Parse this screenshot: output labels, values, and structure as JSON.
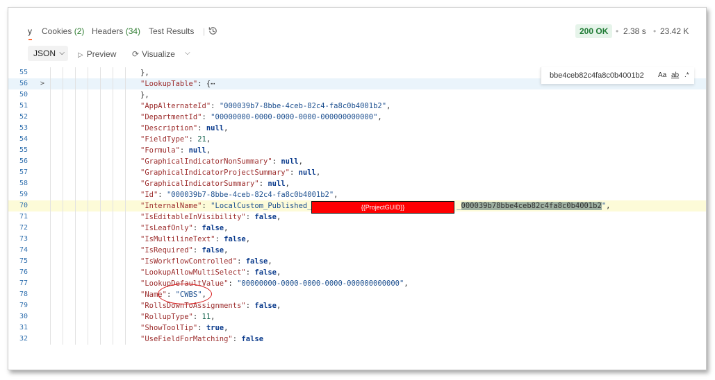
{
  "tabs": {
    "partial_label": "y",
    "cookies_label": "Cookies",
    "cookies_count": "(2)",
    "headers_label": "Headers",
    "headers_count": "(34)",
    "tests_label": "Test Results",
    "separator": "|"
  },
  "response_meta": {
    "status": "200 OK",
    "dot": "•",
    "time": "2.38 s",
    "size": "23.42 K"
  },
  "toolbar": {
    "format": "JSON",
    "preview_label": "Preview",
    "visualize_label": "Visualize"
  },
  "find": {
    "query": "bbe4ceb82c4fa8c0b4001b2",
    "match_case": "Aa",
    "whole_word": "ab",
    "regex": ".*"
  },
  "redaction": {
    "label": "{{ProjectGUID}}"
  },
  "colors": {
    "accent_orange": "#ff6c37",
    "status_green": "#1e7b34",
    "redaction_red": "#ff0000",
    "annotation_red": "#d81b1b"
  },
  "code_lines": [
    {
      "num": "55",
      "tokens": [
        [
          "p",
          "},"
        ]
      ]
    },
    {
      "num": "56",
      "fold": ">",
      "tokens": [
        [
          "k",
          "\"LookupTable\""
        ],
        [
          "p",
          ": {"
        ],
        [
          "p",
          "⋯"
        ]
      ]
    },
    {
      "num": "50",
      "tokens": [
        [
          "p",
          "},"
        ]
      ]
    },
    {
      "num": "51",
      "tokens": [
        [
          "k",
          "\"AppAlternateId\""
        ],
        [
          "p",
          ": "
        ],
        [
          "s",
          "\"000039b7-8bbe-4ceb-82c4-fa8c0b4001b2\""
        ],
        [
          "p",
          ","
        ]
      ]
    },
    {
      "num": "52",
      "tokens": [
        [
          "k",
          "\"DepartmentId\""
        ],
        [
          "p",
          ": "
        ],
        [
          "s",
          "\"00000000-0000-0000-0000-000000000000\""
        ],
        [
          "p",
          ","
        ]
      ]
    },
    {
      "num": "53",
      "tokens": [
        [
          "k",
          "\"Description\""
        ],
        [
          "p",
          ": "
        ],
        [
          "b",
          "null"
        ],
        [
          "p",
          ","
        ]
      ]
    },
    {
      "num": "54",
      "tokens": [
        [
          "k",
          "\"FieldType\""
        ],
        [
          "p",
          ": "
        ],
        [
          "n",
          "21"
        ],
        [
          "p",
          ","
        ]
      ]
    },
    {
      "num": "55",
      "tokens": [
        [
          "k",
          "\"Formula\""
        ],
        [
          "p",
          ": "
        ],
        [
          "b",
          "null"
        ],
        [
          "p",
          ","
        ]
      ]
    },
    {
      "num": "56",
      "tokens": [
        [
          "k",
          "\"GraphicalIndicatorNonSummary\""
        ],
        [
          "p",
          ": "
        ],
        [
          "b",
          "null"
        ],
        [
          "p",
          ","
        ]
      ]
    },
    {
      "num": "57",
      "tokens": [
        [
          "k",
          "\"GraphicalIndicatorProjectSummary\""
        ],
        [
          "p",
          ": "
        ],
        [
          "b",
          "null"
        ],
        [
          "p",
          ","
        ]
      ]
    },
    {
      "num": "58",
      "tokens": [
        [
          "k",
          "\"GraphicalIndicatorSummary\""
        ],
        [
          "p",
          ": "
        ],
        [
          "b",
          "null"
        ],
        [
          "p",
          ","
        ]
      ]
    },
    {
      "num": "59",
      "tokens": [
        [
          "k",
          "\"Id\""
        ],
        [
          "p",
          ": "
        ],
        [
          "s",
          "\"000039b7-8bbe-4ceb-82c4-fa8c0b4001b2\""
        ],
        [
          "p",
          ","
        ]
      ]
    },
    {
      "num": "70",
      "tokens": [
        [
          "k",
          "\"InternalName\""
        ],
        [
          "p",
          ": "
        ],
        [
          "s",
          "\"LocalCustom_Published_"
        ],
        [
          "gap",
          "                                 "
        ],
        [
          "s",
          "_"
        ],
        [
          "sel",
          "000039b78bbe4ceb82c4fa8c0b4001b2"
        ],
        [
          "s",
          "\""
        ],
        [
          "p",
          ","
        ]
      ]
    },
    {
      "num": "71",
      "tokens": [
        [
          "k",
          "\"IsEditableInVisibility\""
        ],
        [
          "p",
          ": "
        ],
        [
          "b",
          "false"
        ],
        [
          "p",
          ","
        ]
      ]
    },
    {
      "num": "72",
      "tokens": [
        [
          "k",
          "\"IsLeafOnly\""
        ],
        [
          "p",
          ": "
        ],
        [
          "b",
          "false"
        ],
        [
          "p",
          ","
        ]
      ]
    },
    {
      "num": "73",
      "tokens": [
        [
          "k",
          "\"IsMultilineText\""
        ],
        [
          "p",
          ": "
        ],
        [
          "b",
          "false"
        ],
        [
          "p",
          ","
        ]
      ]
    },
    {
      "num": "74",
      "tokens": [
        [
          "k",
          "\"IsRequired\""
        ],
        [
          "p",
          ": "
        ],
        [
          "b",
          "false"
        ],
        [
          "p",
          ","
        ]
      ]
    },
    {
      "num": "75",
      "tokens": [
        [
          "k",
          "\"IsWorkflowControlled\""
        ],
        [
          "p",
          ": "
        ],
        [
          "b",
          "false"
        ],
        [
          "p",
          ","
        ]
      ]
    },
    {
      "num": "76",
      "tokens": [
        [
          "k",
          "\"LookupAllowMultiSelect\""
        ],
        [
          "p",
          ": "
        ],
        [
          "b",
          "false"
        ],
        [
          "p",
          ","
        ]
      ]
    },
    {
      "num": "77",
      "tokens": [
        [
          "k",
          "\"LookupDefaultValue\""
        ],
        [
          "p",
          ": "
        ],
        [
          "s",
          "\"00000000-0000-0000-0000-000000000000\""
        ],
        [
          "p",
          ","
        ]
      ]
    },
    {
      "num": "78",
      "tokens": [
        [
          "k",
          "\"Name\""
        ],
        [
          "p",
          ": "
        ],
        [
          "s",
          "\"CWBS\""
        ],
        [
          "p",
          ","
        ]
      ]
    },
    {
      "num": "79",
      "tokens": [
        [
          "k",
          "\"RollsDownToAssignments\""
        ],
        [
          "p",
          ": "
        ],
        [
          "b",
          "false"
        ],
        [
          "p",
          ","
        ]
      ]
    },
    {
      "num": "30",
      "tokens": [
        [
          "k",
          "\"RollupType\""
        ],
        [
          "p",
          ": "
        ],
        [
          "n",
          "11"
        ],
        [
          "p",
          ","
        ]
      ]
    },
    {
      "num": "31",
      "tokens": [
        [
          "k",
          "\"ShowToolTip\""
        ],
        [
          "p",
          ": "
        ],
        [
          "b",
          "true"
        ],
        [
          "p",
          ","
        ]
      ]
    },
    {
      "num": "32",
      "tokens": [
        [
          "k",
          "\"UseFieldForMatching\""
        ],
        [
          "p",
          ": "
        ],
        [
          "b",
          "false"
        ]
      ]
    }
  ]
}
